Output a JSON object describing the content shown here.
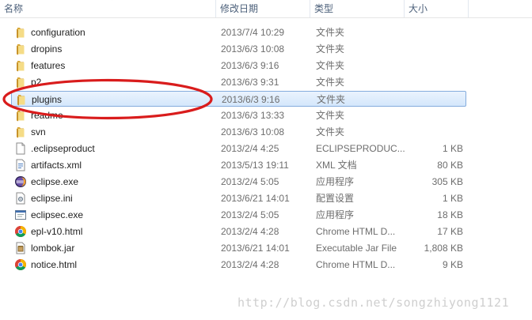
{
  "columns": {
    "name": "名称",
    "date": "修改日期",
    "type": "类型",
    "size": "大小"
  },
  "files": [
    {
      "name": "configuration",
      "date": "2013/7/4 10:29",
      "type": "文件夹",
      "size": "",
      "icon": "folder-icon"
    },
    {
      "name": "dropins",
      "date": "2013/6/3 10:08",
      "type": "文件夹",
      "size": "",
      "icon": "folder-icon"
    },
    {
      "name": "features",
      "date": "2013/6/3 9:16",
      "type": "文件夹",
      "size": "",
      "icon": "folder-icon"
    },
    {
      "name": "p2",
      "date": "2013/6/3 9:31",
      "type": "文件夹",
      "size": "",
      "icon": "folder-icon"
    },
    {
      "name": "plugins",
      "date": "2013/6/3 9:16",
      "type": "文件夹",
      "size": "",
      "icon": "folder-icon",
      "selected": true
    },
    {
      "name": "readme",
      "date": "2013/6/3 13:33",
      "type": "文件夹",
      "size": "",
      "icon": "folder-icon"
    },
    {
      "name": "svn",
      "date": "2013/6/3 10:08",
      "type": "文件夹",
      "size": "",
      "icon": "folder-icon"
    },
    {
      "name": ".eclipseproduct",
      "date": "2013/2/4 4:25",
      "type": "ECLIPSEPRODUC...",
      "size": "1 KB",
      "icon": "blank-file-icon"
    },
    {
      "name": "artifacts.xml",
      "date": "2013/5/13 19:11",
      "type": "XML 文档",
      "size": "80 KB",
      "icon": "xml-file-icon"
    },
    {
      "name": "eclipse.exe",
      "date": "2013/2/4 5:05",
      "type": "应用程序",
      "size": "305 KB",
      "icon": "eclipse-icon"
    },
    {
      "name": "eclipse.ini",
      "date": "2013/6/21 14:01",
      "type": "配置设置",
      "size": "1 KB",
      "icon": "ini-file-icon"
    },
    {
      "name": "eclipsec.exe",
      "date": "2013/2/4 5:05",
      "type": "应用程序",
      "size": "18 KB",
      "icon": "exe-file-icon"
    },
    {
      "name": "epl-v10.html",
      "date": "2013/2/4 4:28",
      "type": "Chrome HTML D...",
      "size": "17 KB",
      "icon": "chrome-icon"
    },
    {
      "name": "lombok.jar",
      "date": "2013/6/21 14:01",
      "type": "Executable Jar File",
      "size": "1,808 KB",
      "icon": "jar-file-icon"
    },
    {
      "name": "notice.html",
      "date": "2013/2/4 4:28",
      "type": "Chrome HTML D...",
      "size": "9 KB",
      "icon": "chrome-icon"
    }
  ],
  "watermark": "http://blog.csdn.net/songzhiyong1121",
  "colors": {
    "header_text": "#4c607a",
    "selection_border": "#84acdd",
    "annotation_red": "#d91c1c",
    "folder": "#e8c15a"
  }
}
